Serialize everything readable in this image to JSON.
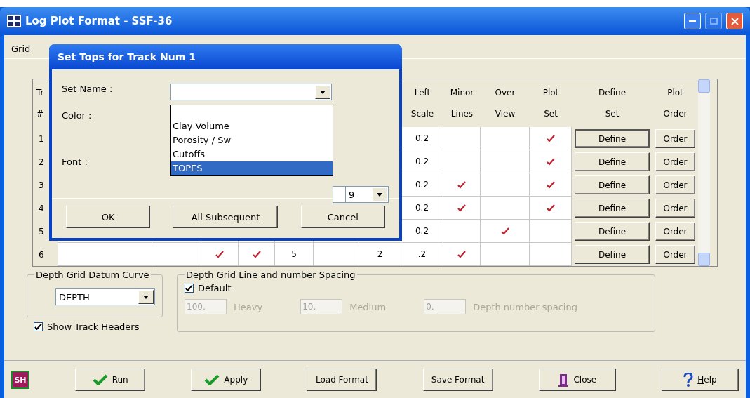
{
  "window": {
    "title": "Log Plot Format - SSF-36",
    "controls": [
      {
        "kind": "minimize",
        "disabled": false
      },
      {
        "kind": "maximize",
        "disabled": true
      },
      {
        "kind": "close",
        "disabled": false
      }
    ]
  },
  "tabs": [
    {
      "label": "Grid",
      "selected": true
    }
  ],
  "table": {
    "columns": [
      {
        "lines": [
          "Tr",
          "#"
        ]
      },
      {
        "lines": [
          "Left",
          "Scale"
        ]
      },
      {
        "lines": [
          "Minor",
          "Lines"
        ]
      },
      {
        "lines": [
          "Over",
          "View"
        ]
      },
      {
        "lines": [
          "Plot",
          "Set"
        ]
      },
      {
        "lines": [
          "Define",
          "Set"
        ]
      },
      {
        "lines": [
          "Plot",
          "Order"
        ]
      }
    ],
    "rows": [
      {
        "track": "1",
        "left_scale": "0.2",
        "minor_lines": false,
        "over_view": false,
        "plot_set": true,
        "define": "Define",
        "order": "Order",
        "focused": true
      },
      {
        "track": "2",
        "left_scale": "0.2",
        "minor_lines": false,
        "over_view": false,
        "plot_set": true,
        "define": "Define",
        "order": "Order",
        "focused": false
      },
      {
        "track": "3",
        "left_scale": "0.2",
        "minor_lines": true,
        "over_view": false,
        "plot_set": true,
        "define": "Define",
        "order": "Order",
        "focused": false
      },
      {
        "track": "4",
        "left_scale": "0.2",
        "minor_lines": true,
        "over_view": false,
        "plot_set": true,
        "define": "Define",
        "order": "Order",
        "focused": false
      },
      {
        "track": "5",
        "left_scale": "0.2",
        "minor_lines": false,
        "over_view": true,
        "plot_set": false,
        "define": "Define",
        "order": "Order",
        "focused": false
      },
      {
        "track": "6",
        "middle": [
          {
            "kind": "blank"
          },
          {
            "kind": "blank"
          },
          {
            "kind": "check",
            "checked": true
          },
          {
            "kind": "check",
            "checked": true
          },
          {
            "kind": "text",
            "text": "5"
          },
          {
            "kind": "blank"
          },
          {
            "kind": "text",
            "text": "2"
          }
        ],
        "left_scale": ".2",
        "minor_lines": true,
        "over_view": false,
        "plot_set": false,
        "define": "Define",
        "order": "Order",
        "focused": false
      }
    ]
  },
  "datum_group": {
    "title": "Depth Grid Datum Curve",
    "value": "DEPTH"
  },
  "show_track_headers": {
    "label": "Show Track Headers",
    "checked": true
  },
  "spacing_group": {
    "title": "Depth Grid Line and number Spacing",
    "default": {
      "label": "Default",
      "checked": true
    },
    "fields": [
      {
        "value": "100.",
        "suffix": "Heavy",
        "disabled": true
      },
      {
        "value": "10.",
        "suffix": "Medium",
        "disabled": true
      },
      {
        "value": "0.",
        "suffix": "Depth number spacing",
        "disabled": true
      }
    ]
  },
  "footer_buttons": [
    {
      "kind": "logo",
      "label": "SH"
    },
    {
      "kind": "check",
      "label": "Run"
    },
    {
      "kind": "check",
      "label": "Apply"
    },
    {
      "kind": "plain",
      "label": "Load Format"
    },
    {
      "kind": "plain",
      "label": "Save Format"
    },
    {
      "kind": "door",
      "label": "Close"
    },
    {
      "kind": "help",
      "label": "Help"
    }
  ],
  "dialog": {
    "title": "Set Tops for Track Num 1",
    "labels": [
      "Set Name :",
      "Color :",
      "Font :"
    ],
    "font_size": "9",
    "set_name_options": [
      {
        "label": "Clay Volume",
        "selected": false
      },
      {
        "label": "Porosity / Sw",
        "selected": false
      },
      {
        "label": "Cutoffs",
        "selected": false
      },
      {
        "label": "TOPES",
        "selected": true
      }
    ],
    "buttons": [
      "OK",
      "All Subsequent",
      "Cancel"
    ]
  }
}
